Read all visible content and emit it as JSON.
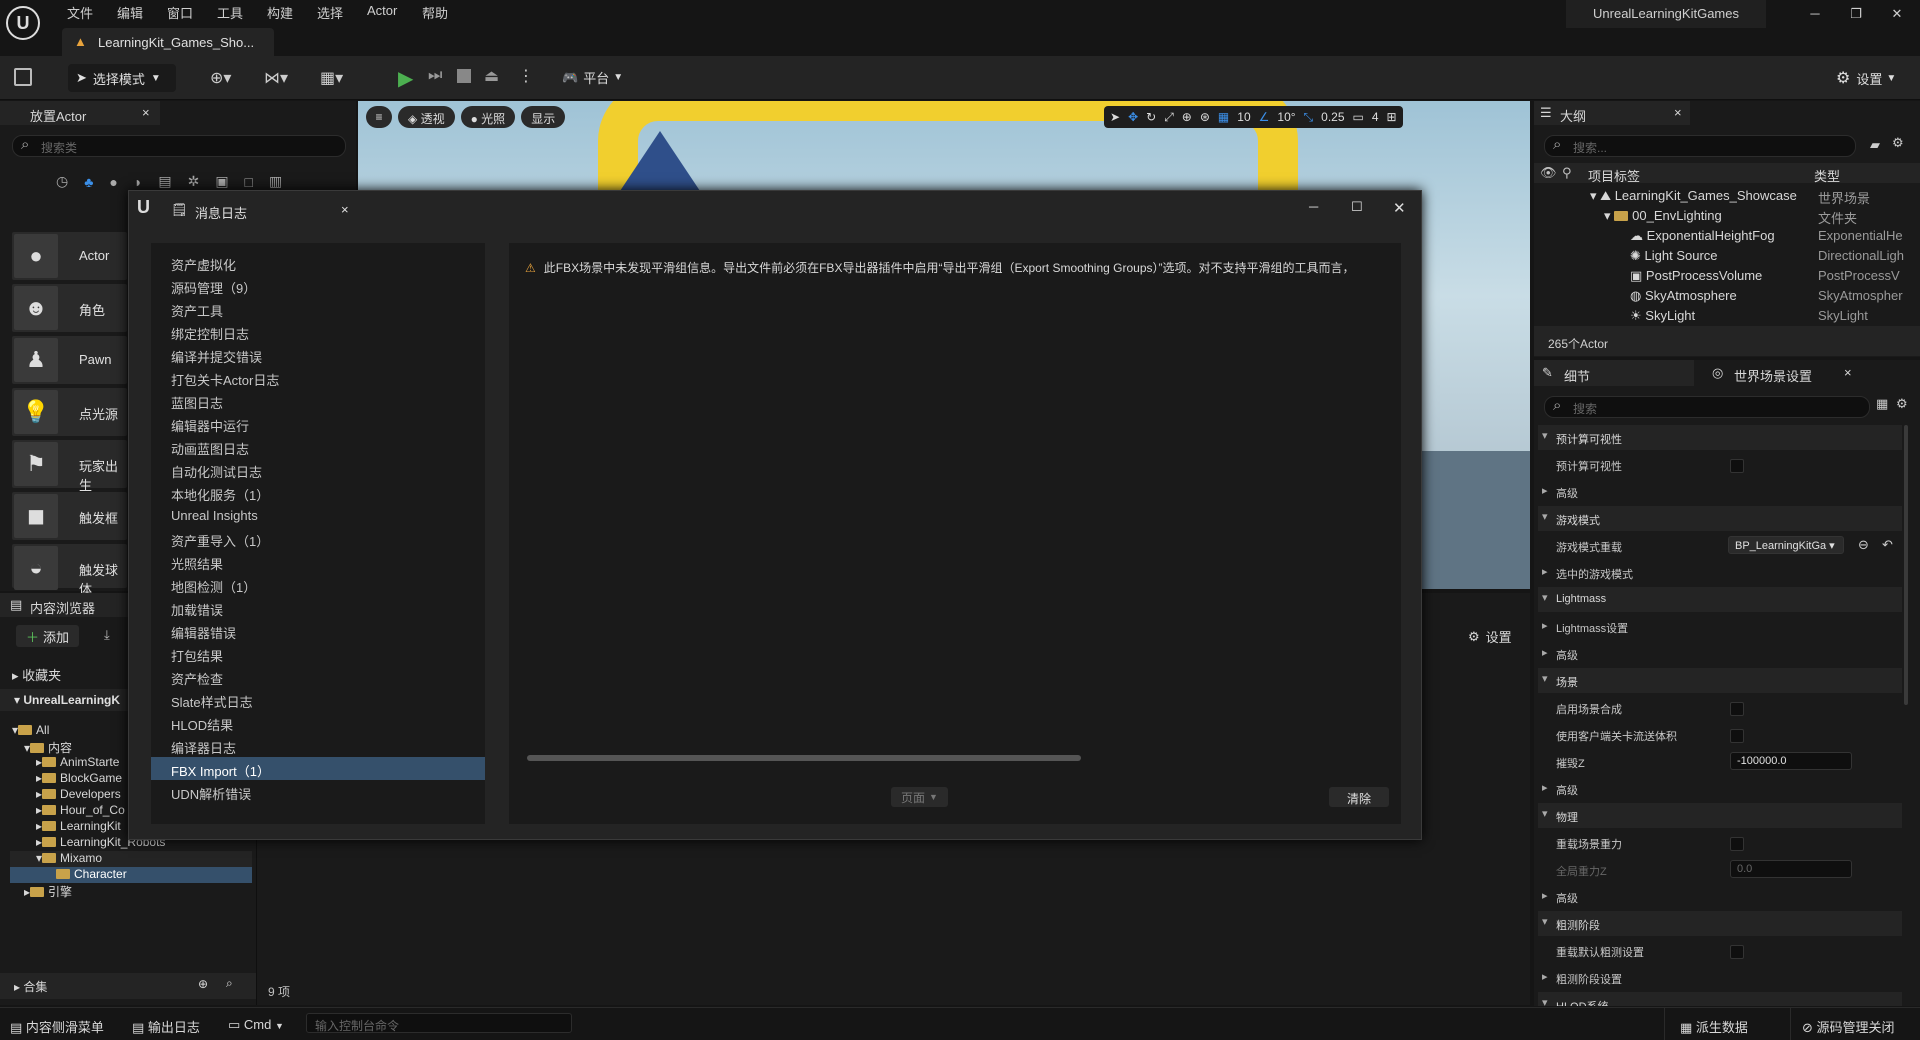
{
  "menu": [
    "文件",
    "编辑",
    "窗口",
    "工具",
    "构建",
    "选择",
    "Actor",
    "帮助"
  ],
  "doc_tab": "LearningKit_Games_Sho...",
  "window_title": "UnrealLearningKitGames",
  "toolbar": {
    "select_mode": "选择模式",
    "platform": "平台",
    "settings": "设置"
  },
  "viewport": {
    "perspective": "透视",
    "lighting": "光照",
    "show": "显示",
    "grid": "10",
    "angle": "10°",
    "scale": "0.25",
    "camera": "4"
  },
  "place_actor": {
    "title": "放置Actor",
    "search_placeholder": "搜索类",
    "items": [
      "Actor",
      "角色",
      "Pawn",
      "点光源",
      "玩家出生",
      "触发框",
      "触发球体"
    ]
  },
  "content_browser": {
    "title": "内容浏览器",
    "add": "添加",
    "favorites": "收藏夹",
    "project": "UnrealLearningK",
    "tree": [
      "All",
      "内容",
      "AnimStarte",
      "BlockGame",
      "Developers",
      "Hour_of_Co",
      "LearningKit",
      "LearningKit_Robots",
      "Mixamo",
      "Character",
      "引擎"
    ],
    "collections": "合集",
    "count": "9 项",
    "settings": "设置"
  },
  "message_log": {
    "title": "消息日志",
    "categories": [
      "资产虚拟化",
      "源码管理（9）",
      "资产工具",
      "绑定控制日志",
      "编译并提交错误",
      "打包关卡Actor日志",
      "蓝图日志",
      "编辑器中运行",
      "动画蓝图日志",
      "自动化测试日志",
      "本地化服务（1）",
      "Unreal Insights",
      "资产重导入（1）",
      "光照结果",
      "地图检测（1）",
      "加载错误",
      "编辑器错误",
      "打包结果",
      "资产检查",
      "Slate样式日志",
      "HLOD结果",
      "编译器日志",
      "FBX Import（1）",
      "UDN解析错误"
    ],
    "selected": "FBX Import（1）",
    "message": "此FBX场景中未发现平滑组信息。导出文件前必须在FBX导出器插件中启用“导出平滑组（Export Smoothing Groups）”选项。对不支持平滑组的工具而言，",
    "page": "页面",
    "clear": "清除"
  },
  "outliner": {
    "title": "大纲",
    "search_placeholder": "搜索...",
    "col_label": "项目标签",
    "col_type": "类型",
    "rows": [
      {
        "label": "LearningKit_Games_Showcase",
        "type": "世界场景"
      },
      {
        "label": "00_EnvLighting",
        "type": "文件夹"
      },
      {
        "label": "ExponentialHeightFog",
        "type": "ExponentialHe"
      },
      {
        "label": "Light Source",
        "type": "DirectionalLigh"
      },
      {
        "label": "PostProcessVolume",
        "type": "PostProcessV"
      },
      {
        "label": "SkyAtmosphere",
        "type": "SkyAtmospher"
      },
      {
        "label": "SkyLight",
        "type": "SkyLight"
      }
    ],
    "actor_count": "265个Actor"
  },
  "details": {
    "tab1": "细节",
    "tab2": "世界场景设置",
    "search_placeholder": "搜索",
    "rows": {
      "precomputed": "预计算可视性",
      "precomputed_prop": "预计算可视性",
      "adv1": "高级",
      "gamemode": "游戏模式",
      "gamemode_override": "游戏模式重载",
      "gamemode_value": "BP_LearningKitGa",
      "selected_gamemode": "选中的游戏模式",
      "lightmass": "Lightmass",
      "lightmass_settings": "Lightmass设置",
      "adv2": "高级",
      "world": "场景",
      "enable_world_comp": "启用场景合成",
      "use_client_stream": "使用客户端关卡流送体积",
      "killz": "摧毁Z",
      "killz_value": "-100000.0",
      "adv3": "高级",
      "physics": "物理",
      "override_gravity": "重载场景重力",
      "global_gravity": "全局重力Z",
      "gravity_value": "0.0",
      "adv4": "高级",
      "broadphase": "粗测阶段",
      "override_broadphase": "重载默认粗测设置",
      "broadphase_settings": "粗测阶段设置",
      "hlod": "HLOD系统"
    }
  },
  "statusbar": {
    "drawer": "内容侧滑菜单",
    "output": "输出日志",
    "cmd": "Cmd",
    "console_placeholder": "输入控制台命令",
    "derived": "派生数据",
    "source": "源码管理关闭"
  }
}
